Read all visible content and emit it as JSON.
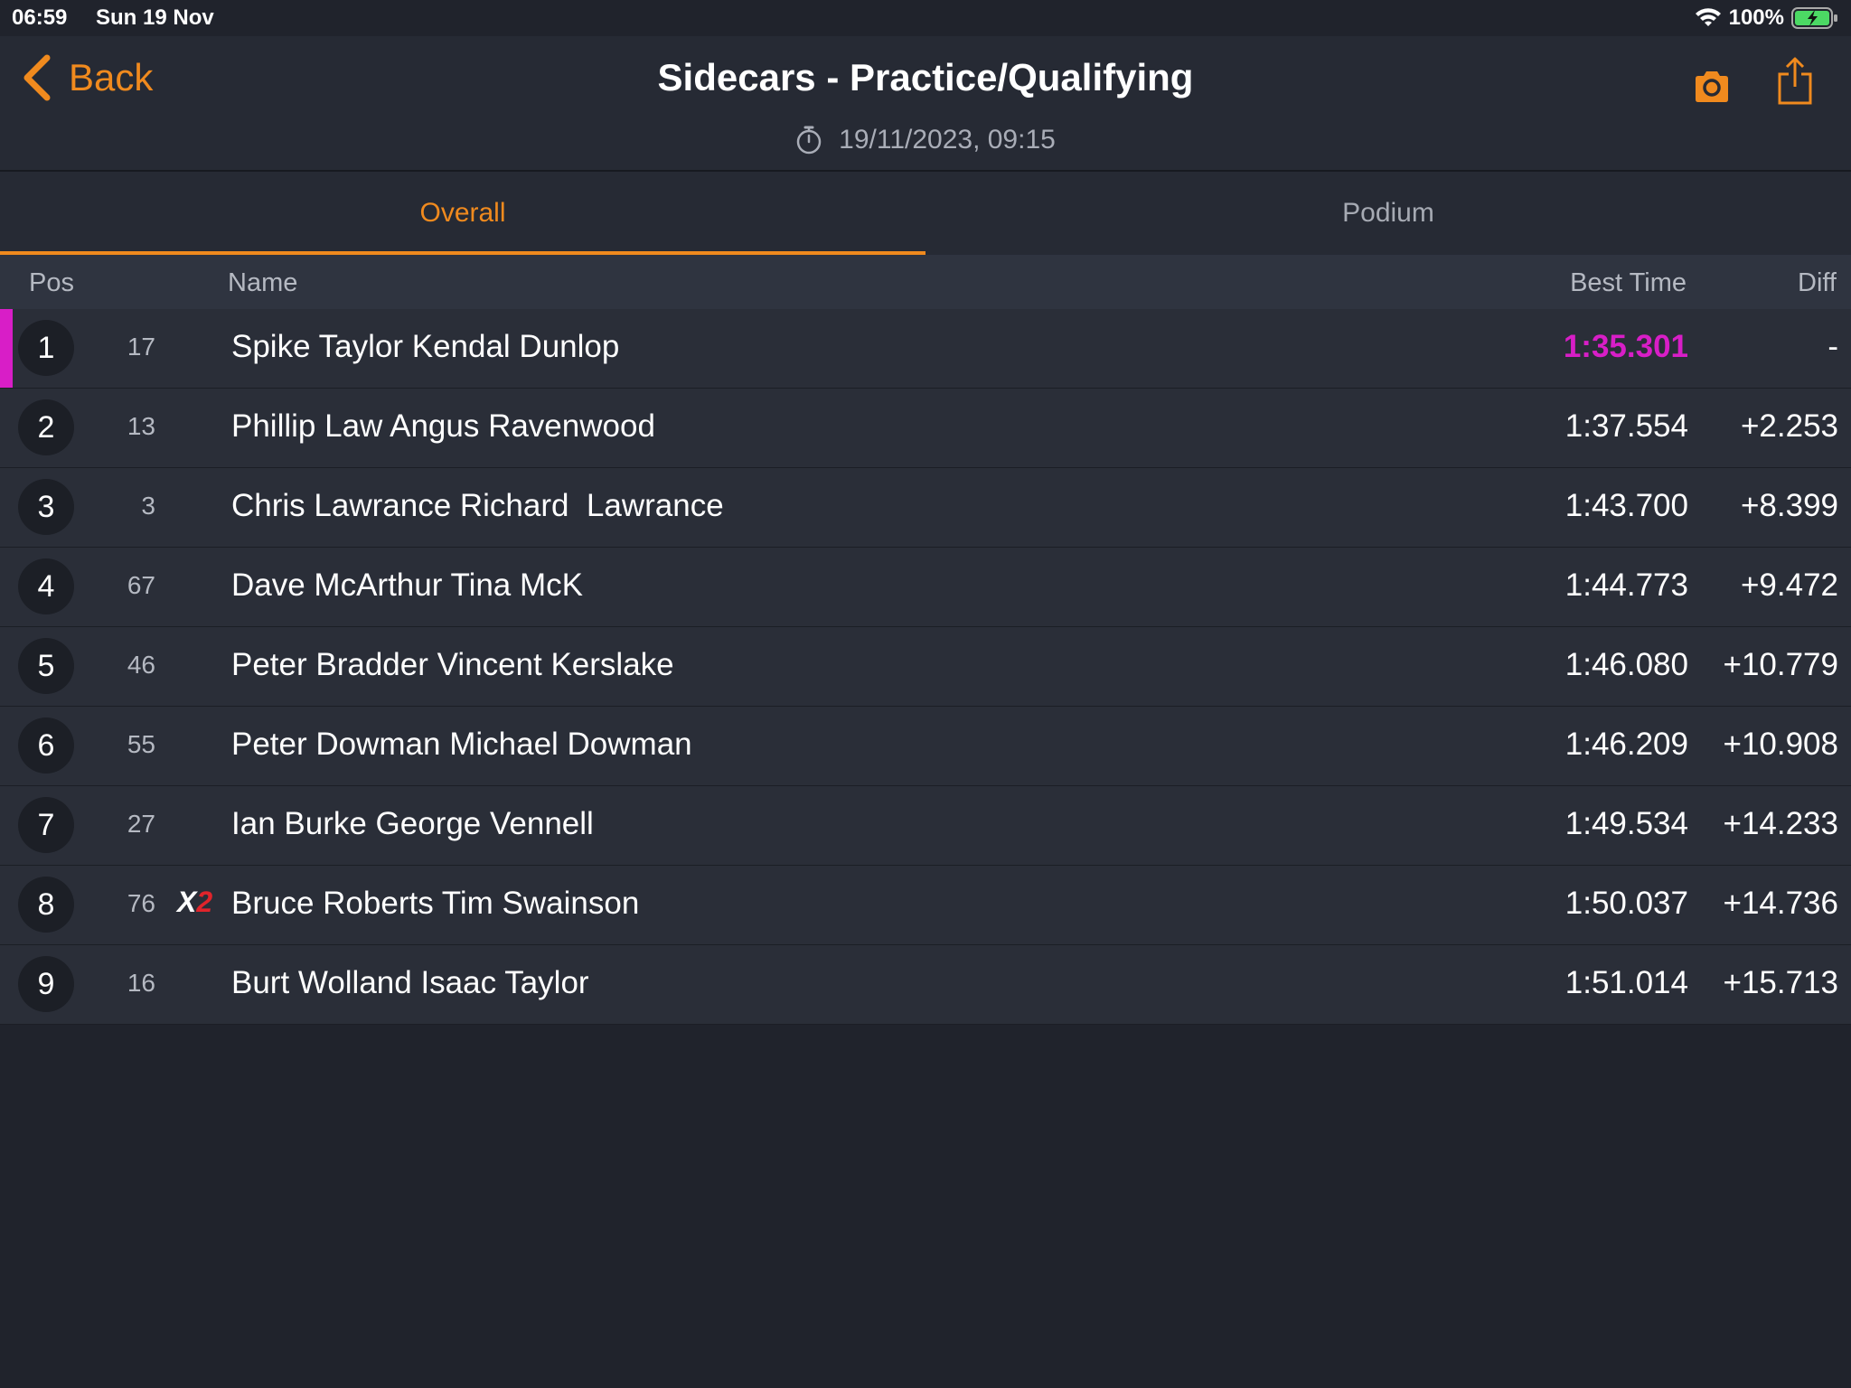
{
  "status_bar": {
    "time": "06:59",
    "date": "Sun 19 Nov",
    "battery": "100%"
  },
  "header": {
    "back_label": "Back",
    "title": "Sidecars - Practice/Qualifying",
    "timestamp": "19/11/2023, 09:15"
  },
  "tabs": [
    {
      "label": "Overall",
      "active": true
    },
    {
      "label": "Podium",
      "active": false
    }
  ],
  "table": {
    "columns": {
      "pos": "Pos",
      "name": "Name",
      "best_time": "Best Time",
      "diff": "Diff"
    },
    "rows": [
      {
        "pos": "1",
        "number": "17",
        "name": "Spike Taylor Kendal Dunlop",
        "best_time": "1:35.301",
        "diff": "-",
        "fastest": true
      },
      {
        "pos": "2",
        "number": "13",
        "name": "Phillip Law Angus Ravenwood",
        "best_time": "1:37.554",
        "diff": "+2.253"
      },
      {
        "pos": "3",
        "number": "3",
        "name": "Chris Lawrance Richard  Lawrance",
        "best_time": "1:43.700",
        "diff": "+8.399"
      },
      {
        "pos": "4",
        "number": "67",
        "name": "Dave McArthur Tina McK",
        "best_time": "1:44.773",
        "diff": "+9.472"
      },
      {
        "pos": "5",
        "number": "46",
        "name": "Peter Bradder Vincent Kerslake",
        "best_time": "1:46.080",
        "diff": "+10.779"
      },
      {
        "pos": "6",
        "number": "55",
        "name": "Peter Dowman Michael Dowman",
        "best_time": "1:46.209",
        "diff": "+10.908"
      },
      {
        "pos": "7",
        "number": "27",
        "name": "Ian Burke George Vennell",
        "best_time": "1:49.534",
        "diff": "+14.233"
      },
      {
        "pos": "8",
        "number": "76",
        "badge": {
          "x": "X",
          "n": "2"
        },
        "name": "Bruce Roberts Tim Swainson",
        "best_time": "1:50.037",
        "diff": "+14.736"
      },
      {
        "pos": "9",
        "number": "16",
        "name": "Burt Wolland Isaac Taylor",
        "best_time": "1:51.014",
        "diff": "+15.713"
      }
    ]
  },
  "colors": {
    "accent": "#f08a1e",
    "fastest": "#d81ec7",
    "background": "#20232c",
    "row": "#2a2e38"
  },
  "icons": {
    "back": "chevron-left-icon",
    "timer": "stopwatch-icon",
    "camera": "camera-icon",
    "share": "share-icon",
    "wifi": "wifi-icon",
    "battery": "battery-charging-icon"
  }
}
